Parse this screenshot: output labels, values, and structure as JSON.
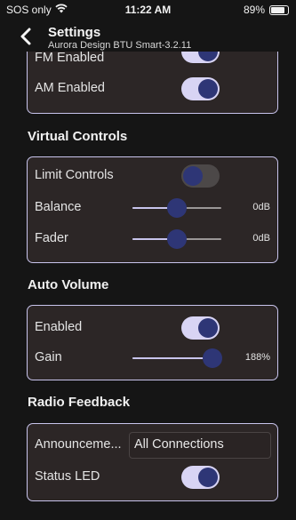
{
  "status_bar": {
    "carrier": "SOS only",
    "time": "11:22 AM",
    "battery": "89%",
    "battery_level": 0.89
  },
  "header": {
    "back_icon": "chevron-left-icon",
    "title": "Settings",
    "subtitle": "Aurora Design BTU Smart-3.2.11"
  },
  "radio_top": {
    "fm_label": "FM Enabled",
    "fm_on": true,
    "am_label": "AM Enabled",
    "am_on": true
  },
  "virtual_controls": {
    "title": "Virtual Controls",
    "limit_label": "Limit Controls",
    "limit_on": false,
    "balance_label": "Balance",
    "balance_value": "0dB",
    "balance_level": 0.5,
    "fader_label": "Fader",
    "fader_value": "0dB",
    "fader_level": 0.5
  },
  "auto_volume": {
    "title": "Auto Volume",
    "enabled_label": "Enabled",
    "enabled_on": true,
    "gain_label": "Gain",
    "gain_value": "188%",
    "gain_level": 0.9
  },
  "radio_feedback": {
    "title": "Radio Feedback",
    "announcement_label": "Announceme...",
    "announcement_value": "All Connections",
    "status_led_label": "Status LED",
    "status_led_on": true
  },
  "colors": {
    "background": "#151515",
    "card_bg": "#2c2626",
    "card_border": "#c8c4ec",
    "toggle_track_on": "#d8d4f4",
    "toggle_knob": "#2e3676"
  }
}
